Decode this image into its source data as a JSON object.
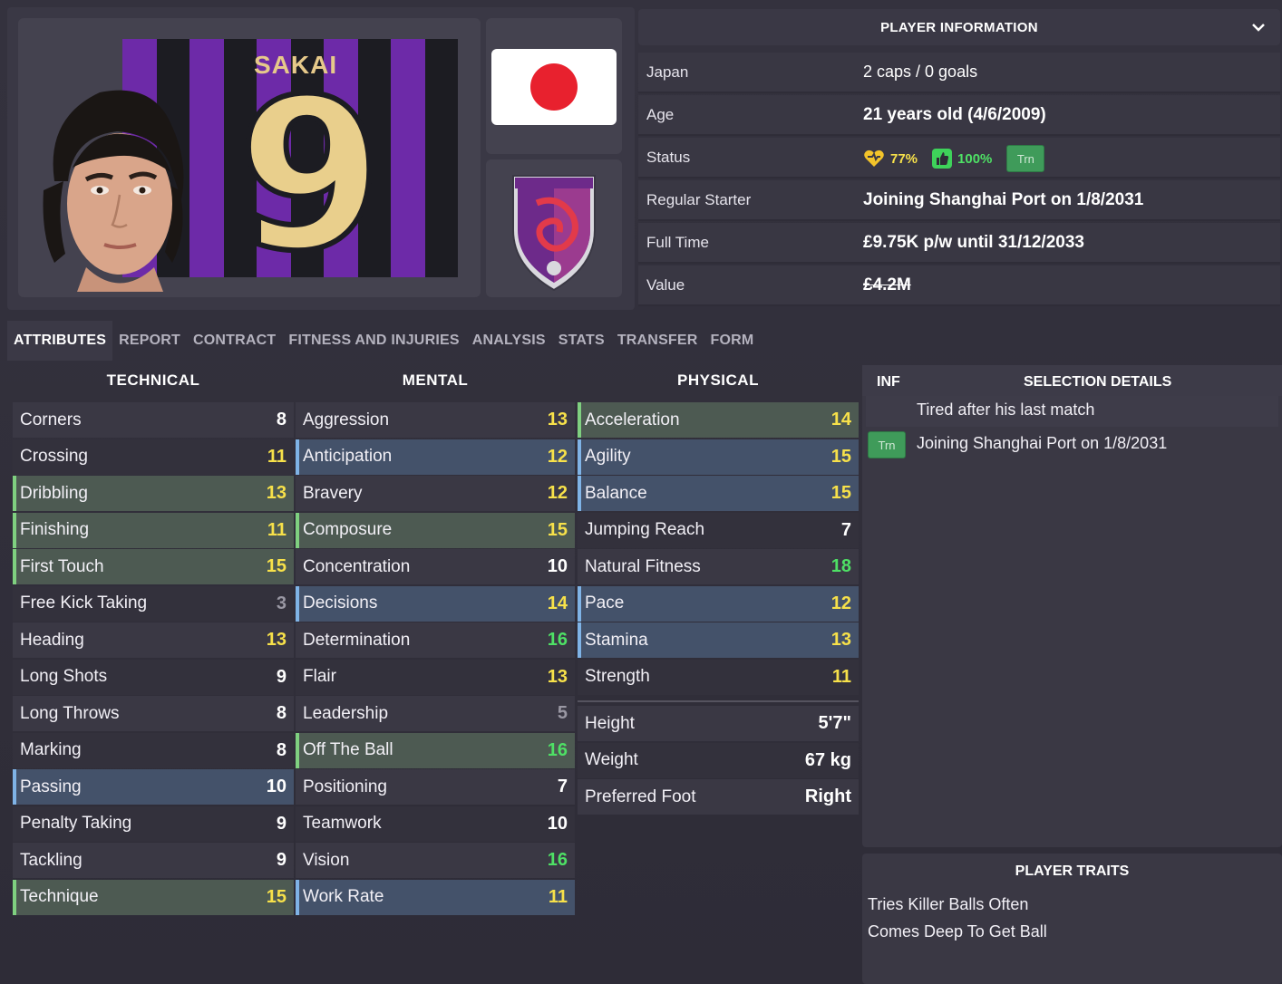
{
  "player": {
    "shirt_name": "SAKAI",
    "shirt_number": "9"
  },
  "info": {
    "header": "PLAYER INFORMATION",
    "rows": [
      {
        "label": "Japan",
        "value": "2 caps / 0 goals"
      },
      {
        "label": "Age",
        "value": "21 years old (4/6/2009)"
      },
      {
        "label": "Status",
        "morale_pct": "77%",
        "fitness_pct": "100%",
        "badge": "Trn"
      },
      {
        "label": "Regular Starter",
        "value": "Joining Shanghai Port on 1/8/2031"
      },
      {
        "label": "Full Time",
        "value": "£9.75K p/w until 31/12/2033"
      },
      {
        "label": "Value",
        "value": "£4.2M"
      }
    ]
  },
  "tabs": [
    "ATTRIBUTES",
    "REPORT",
    "CONTRACT",
    "FITNESS AND INJURIES",
    "ANALYSIS",
    "STATS",
    "TRANSFER",
    "FORM"
  ],
  "columns": {
    "technical": {
      "title": "TECHNICAL",
      "items": [
        {
          "name": "Corners",
          "value": "8"
        },
        {
          "name": "Crossing",
          "value": "11"
        },
        {
          "name": "Dribbling",
          "value": "13"
        },
        {
          "name": "Finishing",
          "value": "11"
        },
        {
          "name": "First Touch",
          "value": "15"
        },
        {
          "name": "Free Kick Taking",
          "value": "3"
        },
        {
          "name": "Heading",
          "value": "13"
        },
        {
          "name": "Long Shots",
          "value": "9"
        },
        {
          "name": "Long Throws",
          "value": "8"
        },
        {
          "name": "Marking",
          "value": "8"
        },
        {
          "name": "Passing",
          "value": "10"
        },
        {
          "name": "Penalty Taking",
          "value": "9"
        },
        {
          "name": "Tackling",
          "value": "9"
        },
        {
          "name": "Technique",
          "value": "15"
        }
      ]
    },
    "mental": {
      "title": "MENTAL",
      "items": [
        {
          "name": "Aggression",
          "value": "13"
        },
        {
          "name": "Anticipation",
          "value": "12"
        },
        {
          "name": "Bravery",
          "value": "12"
        },
        {
          "name": "Composure",
          "value": "15"
        },
        {
          "name": "Concentration",
          "value": "10"
        },
        {
          "name": "Decisions",
          "value": "14"
        },
        {
          "name": "Determination",
          "value": "16"
        },
        {
          "name": "Flair",
          "value": "13"
        },
        {
          "name": "Leadership",
          "value": "5"
        },
        {
          "name": "Off The Ball",
          "value": "16"
        },
        {
          "name": "Positioning",
          "value": "7"
        },
        {
          "name": "Teamwork",
          "value": "10"
        },
        {
          "name": "Vision",
          "value": "16"
        },
        {
          "name": "Work Rate",
          "value": "11"
        }
      ]
    },
    "physical": {
      "title": "PHYSICAL",
      "items": [
        {
          "name": "Acceleration",
          "value": "14"
        },
        {
          "name": "Agility",
          "value": "15"
        },
        {
          "name": "Balance",
          "value": "15"
        },
        {
          "name": "Jumping Reach",
          "value": "7"
        },
        {
          "name": "Natural Fitness",
          "value": "18"
        },
        {
          "name": "Pace",
          "value": "12"
        },
        {
          "name": "Stamina",
          "value": "13"
        },
        {
          "name": "Strength",
          "value": "11"
        }
      ],
      "details": [
        {
          "name": "Height",
          "value": "5'7\""
        },
        {
          "name": "Weight",
          "value": "67 kg"
        },
        {
          "name": "Preferred Foot",
          "value": "Right"
        }
      ]
    }
  },
  "selection": {
    "inf_label": "INF",
    "title": "SELECTION DETAILS",
    "rows": [
      {
        "badge": "",
        "text": "Tired after his last match"
      },
      {
        "badge": "Trn",
        "text": "Joining Shanghai Port on 1/8/2031"
      }
    ]
  },
  "traits": {
    "title": "PLAYER TRAITS",
    "items": [
      "Tries Killer Balls Often",
      "Comes Deep To Get Ball"
    ]
  },
  "icons": {
    "morale": "heart-icon",
    "fitness": "thumbs-up-icon",
    "collapse": "chevron-down-icon"
  },
  "colors": {
    "flag_red": "#e8212e",
    "shirt_purple": "#6d2aa8",
    "value_yellow": "#f7e14a",
    "value_green": "#4ee065",
    "trn_green": "#3f9b5a"
  }
}
